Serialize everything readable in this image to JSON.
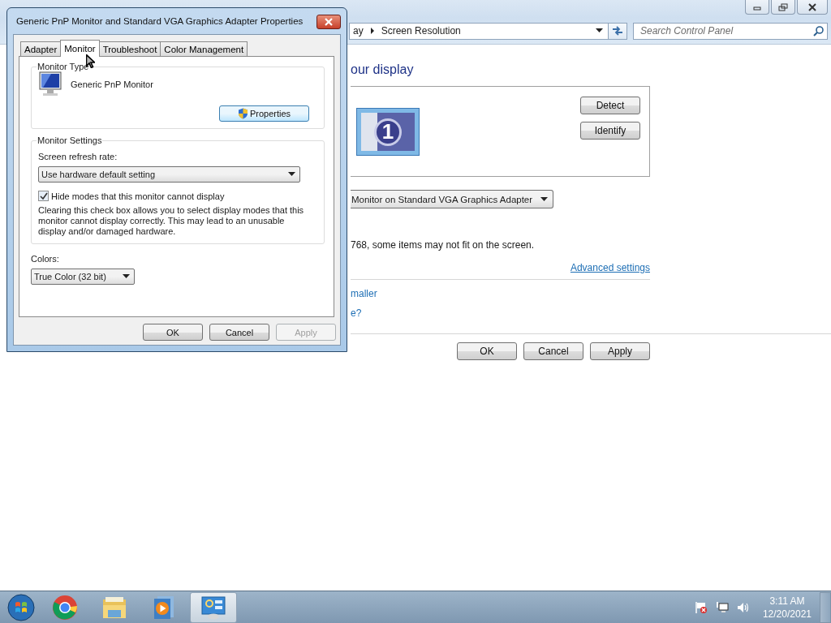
{
  "control_panel": {
    "breadcrumb": [
      "ay",
      "Screen Resolution"
    ],
    "search": {
      "placeholder": "Search Control Panel"
    },
    "heading": "our display",
    "monitor_badge": "1",
    "display_buttons": [
      "Detect",
      "Identify"
    ],
    "display_dropdown": {
      "value": "Monitor on Standard VGA Graphics Adapter"
    },
    "warning": "768, some items may not fit on the screen.",
    "advanced_link": "Advanced settings",
    "links": [
      "maller",
      "e?"
    ],
    "buttons": [
      {
        "label": "OK",
        "disabled": false
      },
      {
        "label": "Cancel",
        "disabled": false
      },
      {
        "label": "Apply",
        "disabled": false
      }
    ]
  },
  "dialog": {
    "title": "Generic PnP Monitor and Standard VGA Graphics Adapter Properties",
    "tabs": [
      {
        "label": "Adapter",
        "selected": false
      },
      {
        "label": "Monitor",
        "selected": true
      },
      {
        "label": "Troubleshoot",
        "selected": false
      },
      {
        "label": "Color Management",
        "selected": false
      }
    ],
    "monitor_type": {
      "legend": "Monitor Type",
      "name": "Generic PnP Monitor",
      "button": "Properties"
    },
    "monitor_settings": {
      "legend": "Monitor Settings",
      "refresh_label": "Screen refresh rate:",
      "refresh_value": "Use hardware default setting",
      "hide_modes": {
        "label": "Hide modes that this monitor cannot display",
        "checked": true
      },
      "note": "Clearing this check box allows you to select display modes that this monitor cannot display correctly. This may lead to an unusable display and/or damaged hardware."
    },
    "colors": {
      "label": "Colors:",
      "value": "True Color (32 bit)"
    },
    "buttons": [
      {
        "label": "OK",
        "disabled": false
      },
      {
        "label": "Cancel",
        "disabled": false
      },
      {
        "label": "Apply",
        "disabled": true
      }
    ]
  },
  "taskbar": {
    "apps": [
      {
        "kind": "browser",
        "selected": false
      },
      {
        "kind": "folder",
        "selected": false
      },
      {
        "kind": "media",
        "selected": false
      },
      {
        "kind": "control-panel",
        "selected": true
      }
    ],
    "clock": {
      "time": "3:11 AM",
      "date": "12/20/2021"
    }
  }
}
